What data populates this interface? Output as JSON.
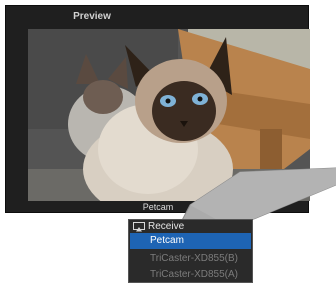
{
  "panel": {
    "title": "Preview",
    "source_label": "Petcam"
  },
  "menu": {
    "header": "Receive",
    "header_icon": "airplay-receive-icon",
    "items": [
      {
        "label": "Petcam",
        "selected": true
      },
      {
        "label": "TriCaster-XD855(B)",
        "selected": false
      },
      {
        "label": "TriCaster-XD855(A)",
        "selected": false
      }
    ]
  },
  "colors": {
    "panel_bg": "#1f1f1f",
    "menu_bg": "#2a2a2a",
    "selection": "#1e64b4"
  }
}
